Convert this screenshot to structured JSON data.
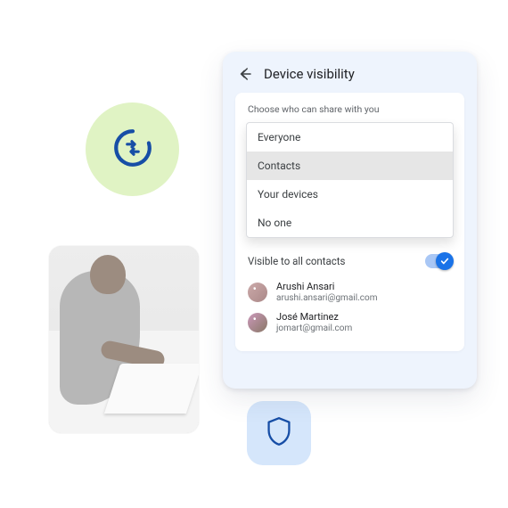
{
  "badges": {
    "sync_name": "sync-icon",
    "shield_name": "shield-icon"
  },
  "panel": {
    "title": "Device visibility",
    "choose_label": "Choose who can share with you",
    "options": [
      {
        "label": "Everyone"
      },
      {
        "label": "Contacts"
      },
      {
        "label": "Your devices"
      },
      {
        "label": "No one"
      }
    ],
    "selected_option_index": 1,
    "toggle": {
      "label": "Visible to all contacts",
      "on": true
    },
    "contacts": [
      {
        "name": "Arushi Ansari",
        "email": "arushi.ansari@gmail.com"
      },
      {
        "name": "José Martinez",
        "email": "jomart@gmail.com"
      }
    ]
  }
}
